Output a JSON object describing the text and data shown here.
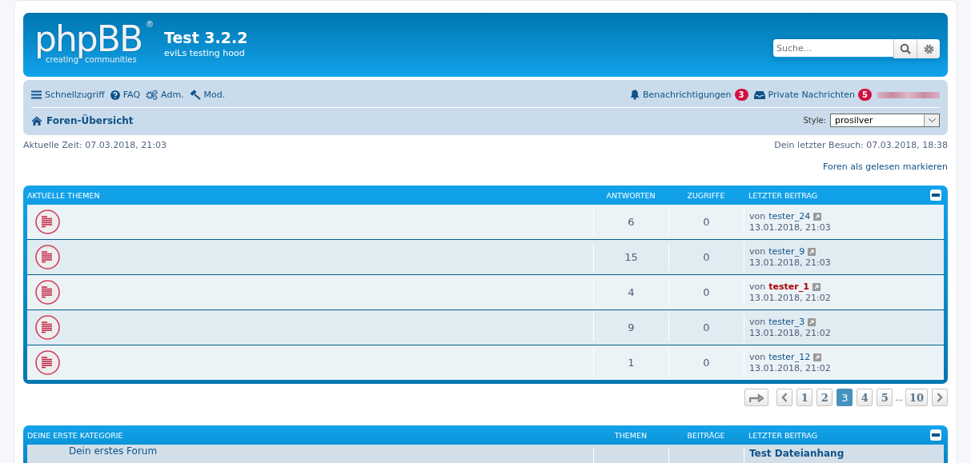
{
  "header": {
    "logo": {
      "name": "phpBB",
      "mark": "®",
      "words": [
        "creating",
        "communities"
      ]
    },
    "title": "Test 3.2.2",
    "subtitle": "eviLs testing hood",
    "search": {
      "placeholder": "Suche..."
    }
  },
  "navbar": {
    "left": [
      {
        "kind": "menu",
        "label": "Schnellzugriff"
      },
      {
        "kind": "help",
        "label": "FAQ"
      },
      {
        "kind": "gears",
        "label": "Adm."
      },
      {
        "kind": "gavel",
        "label": "Mod."
      }
    ],
    "right": [
      {
        "kind": "bell",
        "label": "Benachrichtigungen",
        "count": "3"
      },
      {
        "kind": "inbox",
        "label": "Private Nachrichten",
        "count": "5"
      }
    ],
    "breadcrumb": "Foren-Übersicht",
    "style_label": "Style:",
    "style_value": "prosilver"
  },
  "time_now": "Aktuelle Zeit: 07.03.2018, 21:03",
  "last_visit": "Dein letzter Besuch: 07.03.2018, 18:38",
  "mark_read": "Foren als gelesen markieren",
  "topics": {
    "columns": [
      "AKTUELLE THEMEN",
      "ANTWORTEN",
      "ZUGRIFFE",
      "LETZTER BEITRAG"
    ],
    "rows": [
      {
        "replies": "6",
        "views": "0",
        "by": "von",
        "user": "tester_24",
        "color": "#105289",
        "date": "13.01.2018, 21:03"
      },
      {
        "replies": "15",
        "views": "0",
        "by": "von",
        "user": "tester_9",
        "color": "#105289",
        "date": "13.01.2018, 21:03"
      },
      {
        "replies": "4",
        "views": "0",
        "by": "von",
        "user": "tester_1",
        "color": "#aa0000",
        "date": "13.01.2018, 21:02"
      },
      {
        "replies": "9",
        "views": "0",
        "by": "von",
        "user": "tester_3",
        "color": "#105289",
        "date": "13.01.2018, 21:02"
      },
      {
        "replies": "1",
        "views": "0",
        "by": "von",
        "user": "tester_12",
        "color": "#105289",
        "date": "13.01.2018, 21:02"
      }
    ]
  },
  "pagination": {
    "pages": [
      {
        "label": "1",
        "selected": false
      },
      {
        "label": "2",
        "selected": false
      },
      {
        "label": "3",
        "selected": true
      },
      {
        "label": "4",
        "selected": false
      },
      {
        "label": "5",
        "selected": false
      },
      {
        "label": "...",
        "kind": "gap"
      },
      {
        "label": "10",
        "selected": false
      }
    ]
  },
  "category": {
    "columns": [
      "DEINE ERSTE KATEGORIE",
      "THEMEN",
      "BEITRÄGE",
      "LETZTER BEITRAG"
    ],
    "rows": [
      {
        "forum": "Dein erstes Forum",
        "last": "Test Dateianhang"
      }
    ]
  }
}
